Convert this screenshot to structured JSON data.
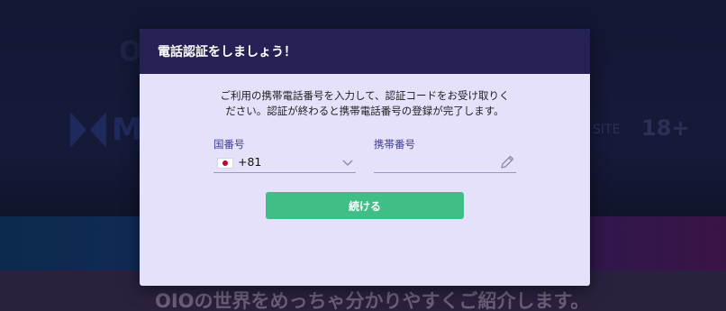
{
  "background": {
    "logo_text": "OIO",
    "brand_m": "M",
    "site_text": "SITE",
    "age_badge": "18+",
    "tagline": "OIOの世界をめっちゃ分かりやすくご紹介します。"
  },
  "modal": {
    "title": "電話認証をしましょう！",
    "description_line1": "ご利用の携帯電話番号を入力して、認証コードをお受け取りく",
    "description_line2": "ださい。認証が終わると携帯電話番号の登録が完了します。",
    "country_label": "国番号",
    "country_value": "+81",
    "phone_label": "携帯番号",
    "phone_value": "",
    "continue_label": "続ける"
  },
  "icons": {
    "flag": "japan-flag-icon",
    "dropdown": "chevron-down-icon",
    "edit": "pencil-icon"
  },
  "colors": {
    "header_bg": "#252155",
    "modal_bg": "#e5e1fb",
    "button_bg": "#3fbf86",
    "label_color": "#3c3c96"
  }
}
